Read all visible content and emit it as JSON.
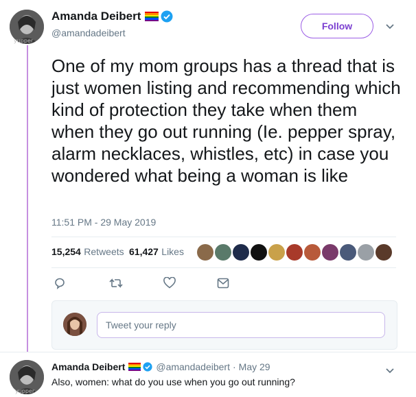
{
  "tweet": {
    "author_name": "Amanda Deibert",
    "author_handle": "@amandadeibert",
    "follow_label": "Follow",
    "text": "One of my mom groups has a thread that is just women listing and recommending which kind of protection they take when them when they go out running (Ie. pepper spray, alarm necklaces, whistles, etc) in case you wondered what being a woman is like",
    "timestamp": "11:51 PM - 29 May 2019",
    "retweets_count": "15,254",
    "retweets_label": "Retweets",
    "likes_count": "61,427",
    "likes_label": "Likes",
    "avatar_watermark": "yupper"
  },
  "reply_composer": {
    "placeholder": "Tweet your reply"
  },
  "reply_tweet": {
    "author_name": "Amanda Deibert",
    "author_handle": "@amandadeibert",
    "separator": "·",
    "date": "May 29",
    "text": "Also, women: what do you use when you go out running?",
    "avatar_watermark": "yupper"
  },
  "colors": {
    "verified": "#1da1f2",
    "accent": "#9b5de5",
    "thread_line": "#c58fe0"
  },
  "icons": [
    "pride-flag-icon",
    "verified-badge-icon",
    "chevron-down-icon",
    "reply-icon",
    "retweet-icon",
    "like-icon",
    "direct-message-icon"
  ]
}
